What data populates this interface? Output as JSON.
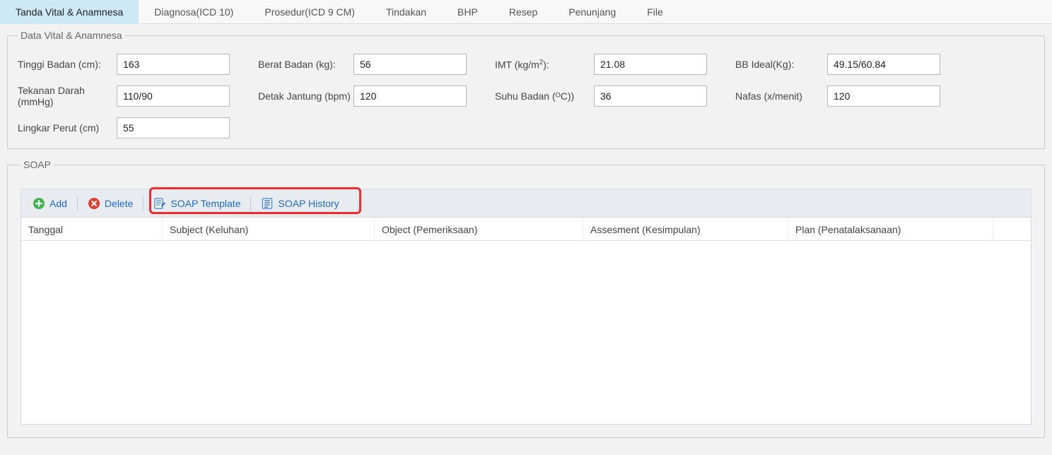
{
  "tabs": [
    "Tanda Vital & Anamnesa",
    "Diagnosa(ICD 10)",
    "Prosedur(ICD 9 CM)",
    "Tindakan",
    "BHP",
    "Resep",
    "Penunjang",
    "File"
  ],
  "vitals": {
    "legend": "Data Vital & Anamnesa",
    "tinggi_label": "Tinggi Badan (cm):",
    "tinggi": "163",
    "berat_label": "Berat Badan (kg):",
    "berat": "56",
    "imt_label_pre": "IMT (kg/m",
    "imt_label_post": "):",
    "imt": "21.08",
    "bbideal_label": "BB Ideal(Kg):",
    "bbideal": "49.15/60.84",
    "tekanan_label": "Tekanan Darah (mmHg)",
    "tekanan": "110/90",
    "detak_label": "Detak Jantung (bpm)",
    "detak": "120",
    "suhu_label": "Suhu Badan (ᴼC))",
    "suhu": "36",
    "nafas_label": "Nafas (x/menit)",
    "nafas": "120",
    "lingkar_label": "Lingkar Perut (cm)",
    "lingkar": "55"
  },
  "soap": {
    "legend": "SOAP",
    "add": "Add",
    "delete": "Delete",
    "template": "SOAP Template",
    "history": "SOAP History",
    "columns": {
      "tanggal": "Tanggal",
      "subject": "Subject (Keluhan)",
      "object": "Object (Pemeriksaan)",
      "assesment": "Assesment (Kesimpulan)",
      "plan": "Plan (Penatalaksanaan)"
    }
  }
}
